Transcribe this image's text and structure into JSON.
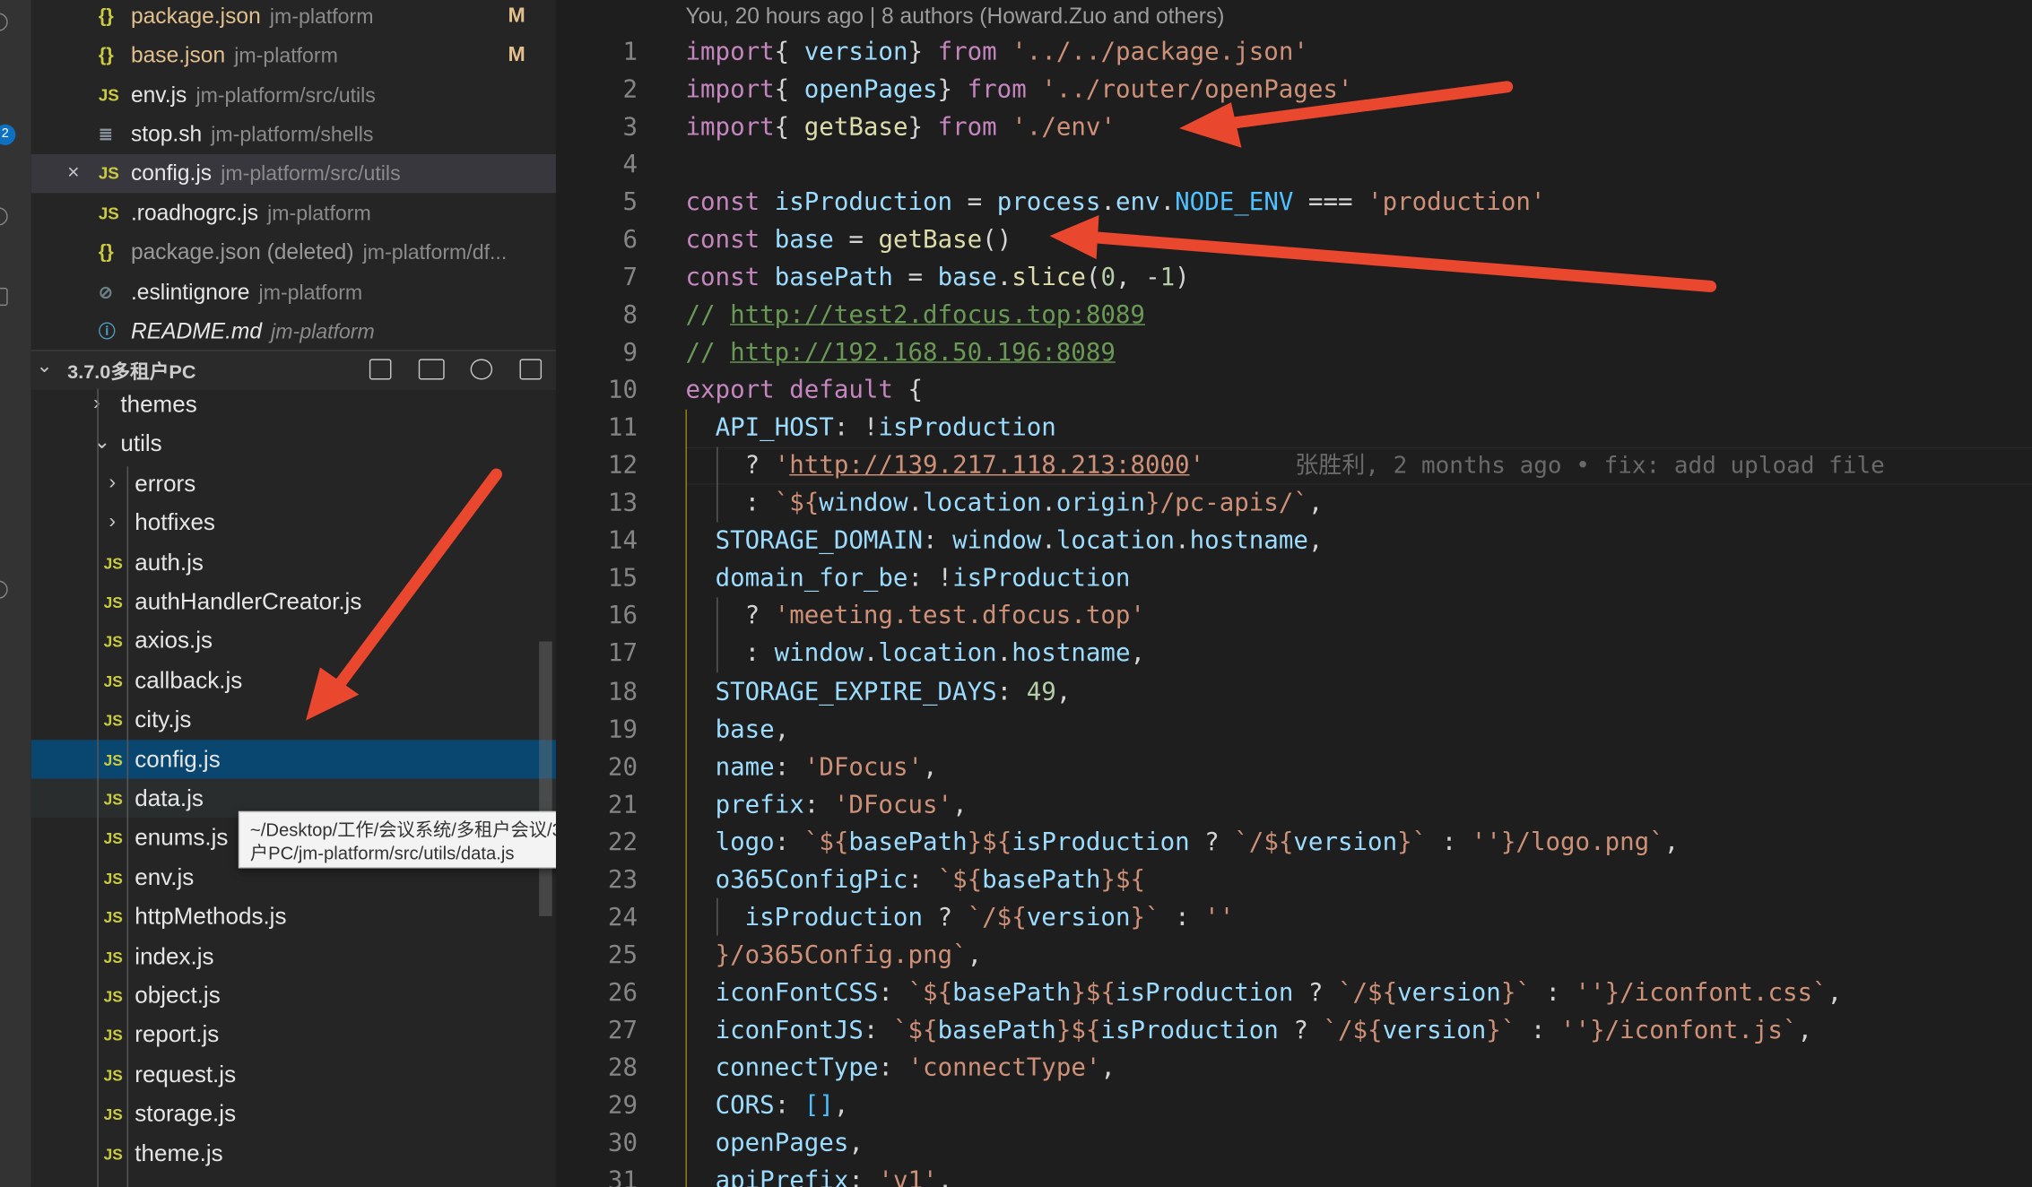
{
  "open_editors": [
    {
      "icon": "{}",
      "name": "package.json",
      "path": "jm-platform",
      "badge": "M",
      "status": "modified"
    },
    {
      "icon": "{}",
      "name": "base.json",
      "path": "jm-platform",
      "badge": "M",
      "status": "modified"
    },
    {
      "icon": "JS",
      "name": "env.js",
      "path": "jm-platform/src/utils",
      "badge": "",
      "status": ""
    },
    {
      "icon": "≣",
      "name": "stop.sh",
      "path": "jm-platform/shells",
      "badge": "",
      "status": ""
    },
    {
      "icon": "JS",
      "name": "config.js",
      "path": "jm-platform/src/utils",
      "badge": "",
      "status": "active",
      "close": "×"
    },
    {
      "icon": "JS",
      "name": ".roadhogrc.js",
      "path": "jm-platform",
      "badge": "",
      "status": ""
    },
    {
      "icon": "{}",
      "name": "package.json (deleted)",
      "path": "jm-platform/df...",
      "badge": "",
      "status": "deleted"
    },
    {
      "icon": "⊘",
      "name": ".eslintignore",
      "path": "jm-platform",
      "badge": "",
      "status": ""
    },
    {
      "icon": "ⓘ",
      "name": "README.md",
      "path": "jm-platform",
      "badge": "",
      "status": "italic"
    }
  ],
  "section": {
    "chevron": "⌄",
    "title": "3.7.0多租户PC"
  },
  "tree": [
    {
      "type": "folder",
      "label": "themes",
      "chevron": "›",
      "depth": 1
    },
    {
      "type": "folder",
      "label": "utils",
      "chevron": "⌄",
      "depth": 1
    },
    {
      "type": "folder",
      "label": "errors",
      "chevron": "›",
      "depth": 2
    },
    {
      "type": "folder",
      "label": "hotfixes",
      "chevron": "›",
      "depth": 2
    },
    {
      "type": "file",
      "label": "auth.js",
      "icon": "JS"
    },
    {
      "type": "file",
      "label": "authHandlerCreator.js",
      "icon": "JS"
    },
    {
      "type": "file",
      "label": "axios.js",
      "icon": "JS"
    },
    {
      "type": "file",
      "label": "callback.js",
      "icon": "JS"
    },
    {
      "type": "file",
      "label": "city.js",
      "icon": "JS"
    },
    {
      "type": "file",
      "label": "config.js",
      "icon": "JS",
      "state": "selected"
    },
    {
      "type": "file",
      "label": "data.js",
      "icon": "JS",
      "state": "hover"
    },
    {
      "type": "file",
      "label": "enums.js",
      "icon": "JS"
    },
    {
      "type": "file",
      "label": "env.js",
      "icon": "JS"
    },
    {
      "type": "file",
      "label": "httpMethods.js",
      "icon": "JS"
    },
    {
      "type": "file",
      "label": "index.js",
      "icon": "JS"
    },
    {
      "type": "file",
      "label": "object.js",
      "icon": "JS"
    },
    {
      "type": "file",
      "label": "report.js",
      "icon": "JS"
    },
    {
      "type": "file",
      "label": "request.js",
      "icon": "JS"
    },
    {
      "type": "file",
      "label": "storage.js",
      "icon": "JS"
    },
    {
      "type": "file",
      "label": "theme.js",
      "icon": "JS"
    }
  ],
  "tooltip": {
    "line1": "~/Desktop/工作/会议系统/多租户会议/3.7.0多租",
    "line2": "户PC/jm-platform/src/utils/data.js"
  },
  "activity_badge": "2",
  "codelens": "You, 20 hours ago | 8 authors (Howard.Zuo and others)",
  "blame": "张胜利, 2 months ago • fix: add upload file",
  "code_lines": [
    [
      [
        "k",
        "import"
      ],
      [
        "",
        "{ "
      ],
      [
        "v",
        "version"
      ],
      [
        "",
        "} "
      ],
      [
        "k",
        "from"
      ],
      [
        "",
        " "
      ],
      [
        "s",
        "'../../package.json'"
      ]
    ],
    [
      [
        "k",
        "import"
      ],
      [
        "",
        "{ "
      ],
      [
        "v",
        "openPages"
      ],
      [
        "",
        "} "
      ],
      [
        "k",
        "from"
      ],
      [
        "",
        " "
      ],
      [
        "s",
        "'../router/openPages'"
      ]
    ],
    [
      [
        "k",
        "import"
      ],
      [
        "",
        "{ "
      ],
      [
        "f",
        "getBase"
      ],
      [
        "",
        "} "
      ],
      [
        "k",
        "from"
      ],
      [
        "",
        " "
      ],
      [
        "s",
        "'./env'"
      ]
    ],
    [],
    [
      [
        "k",
        "const"
      ],
      [
        "",
        " "
      ],
      [
        "v",
        "isProduction"
      ],
      [
        "",
        " = "
      ],
      [
        "v",
        "process"
      ],
      [
        "",
        "."
      ],
      [
        "v",
        "env"
      ],
      [
        "",
        "."
      ],
      [
        "cst",
        "NODE_ENV"
      ],
      [
        "",
        " === "
      ],
      [
        "s",
        "'production'"
      ]
    ],
    [
      [
        "k",
        "const"
      ],
      [
        "",
        " "
      ],
      [
        "v",
        "base"
      ],
      [
        "",
        " = "
      ],
      [
        "f",
        "getBase"
      ],
      [
        "",
        "()"
      ]
    ],
    [
      [
        "k",
        "const"
      ],
      [
        "",
        " "
      ],
      [
        "v",
        "basePath"
      ],
      [
        "",
        " = "
      ],
      [
        "v",
        "base"
      ],
      [
        "",
        "."
      ],
      [
        "f",
        "slice"
      ],
      [
        "",
        "("
      ],
      [
        "n",
        "0"
      ],
      [
        "",
        ", -"
      ],
      [
        "n",
        "1"
      ],
      [
        "",
        ")"
      ]
    ],
    [
      [
        "c",
        "// "
      ],
      [
        "cu",
        "http://test2.dfocus.top:8089"
      ]
    ],
    [
      [
        "c",
        "// "
      ],
      [
        "cu",
        "http://192.168.50.196:8089"
      ]
    ],
    [
      [
        "k",
        "export"
      ],
      [
        "",
        " "
      ],
      [
        "k",
        "default"
      ],
      [
        "",
        " {"
      ]
    ],
    [
      [
        "",
        "  "
      ],
      [
        "v",
        "API_HOST"
      ],
      [
        "",
        ": !"
      ],
      [
        "v",
        "isProduction"
      ]
    ],
    [
      [
        "",
        "    ? "
      ],
      [
        "s",
        "'"
      ],
      [
        "su",
        "http://139.217.118.213:8000"
      ],
      [
        "s",
        "'"
      ],
      [
        "blame",
        ""
      ]
    ],
    [
      [
        "",
        "    : "
      ],
      [
        "s",
        "`${"
      ],
      [
        "v",
        "window"
      ],
      [
        "",
        "."
      ],
      [
        "v",
        "location"
      ],
      [
        "",
        "."
      ],
      [
        "v",
        "origin"
      ],
      [
        "s",
        "}/pc-apis/`"
      ],
      [
        "",
        ","
      ]
    ],
    [
      [
        "",
        "  "
      ],
      [
        "v",
        "STORAGE_DOMAIN"
      ],
      [
        "",
        ": "
      ],
      [
        "v",
        "window"
      ],
      [
        "",
        "."
      ],
      [
        "v",
        "location"
      ],
      [
        "",
        "."
      ],
      [
        "v",
        "hostname"
      ],
      [
        "",
        ","
      ]
    ],
    [
      [
        "",
        "  "
      ],
      [
        "v",
        "domain_for_be"
      ],
      [
        "",
        ": !"
      ],
      [
        "v",
        "isProduction"
      ]
    ],
    [
      [
        "",
        "    ? "
      ],
      [
        "s",
        "'meeting.test.dfocus.top'"
      ]
    ],
    [
      [
        "",
        "    : "
      ],
      [
        "v",
        "window"
      ],
      [
        "",
        "."
      ],
      [
        "v",
        "location"
      ],
      [
        "",
        "."
      ],
      [
        "v",
        "hostname"
      ],
      [
        "",
        ","
      ]
    ],
    [
      [
        "",
        "  "
      ],
      [
        "v",
        "STORAGE_EXPIRE_DAYS"
      ],
      [
        "",
        ": "
      ],
      [
        "n",
        "49"
      ],
      [
        "",
        ","
      ]
    ],
    [
      [
        "",
        "  "
      ],
      [
        "v",
        "base"
      ],
      [
        "",
        ","
      ]
    ],
    [
      [
        "",
        "  "
      ],
      [
        "v",
        "name"
      ],
      [
        "",
        ": "
      ],
      [
        "s",
        "'DFocus'"
      ],
      [
        "",
        ","
      ]
    ],
    [
      [
        "",
        "  "
      ],
      [
        "v",
        "prefix"
      ],
      [
        "",
        ": "
      ],
      [
        "s",
        "'DFocus'"
      ],
      [
        "",
        ","
      ]
    ],
    [
      [
        "",
        "  "
      ],
      [
        "v",
        "logo"
      ],
      [
        "",
        ": "
      ],
      [
        "s",
        "`${"
      ],
      [
        "v",
        "basePath"
      ],
      [
        "s",
        "}${"
      ],
      [
        "v",
        "isProduction"
      ],
      [
        "",
        " ? "
      ],
      [
        "s",
        "`/${"
      ],
      [
        "v",
        "version"
      ],
      [
        "s",
        "}`"
      ],
      [
        "",
        " : "
      ],
      [
        "s",
        "''"
      ],
      [
        "s",
        "}/logo.png`"
      ],
      [
        "",
        ","
      ]
    ],
    [
      [
        "",
        "  "
      ],
      [
        "v",
        "o365ConfigPic"
      ],
      [
        "",
        ": "
      ],
      [
        "s",
        "`${"
      ],
      [
        "v",
        "basePath"
      ],
      [
        "s",
        "}${"
      ]
    ],
    [
      [
        "",
        "    "
      ],
      [
        "v",
        "isProduction"
      ],
      [
        "",
        " ? "
      ],
      [
        "s",
        "`/${"
      ],
      [
        "v",
        "version"
      ],
      [
        "s",
        "}`"
      ],
      [
        "",
        " : "
      ],
      [
        "s",
        "''"
      ]
    ],
    [
      [
        "",
        "  "
      ],
      [
        "s",
        "}/o365Config.png`"
      ],
      [
        "",
        ","
      ]
    ],
    [
      [
        "",
        "  "
      ],
      [
        "v",
        "iconFontCSS"
      ],
      [
        "",
        ": "
      ],
      [
        "s",
        "`${"
      ],
      [
        "v",
        "basePath"
      ],
      [
        "s",
        "}${"
      ],
      [
        "v",
        "isProduction"
      ],
      [
        "",
        " ? "
      ],
      [
        "s",
        "`/${"
      ],
      [
        "v",
        "version"
      ],
      [
        "s",
        "}`"
      ],
      [
        "",
        " : "
      ],
      [
        "s",
        "''"
      ],
      [
        "s",
        "}/iconfont.css`"
      ],
      [
        "",
        ","
      ]
    ],
    [
      [
        "",
        "  "
      ],
      [
        "v",
        "iconFontJS"
      ],
      [
        "",
        ": "
      ],
      [
        "s",
        "`${"
      ],
      [
        "v",
        "basePath"
      ],
      [
        "s",
        "}${"
      ],
      [
        "v",
        "isProduction"
      ],
      [
        "",
        " ? "
      ],
      [
        "s",
        "`/${"
      ],
      [
        "v",
        "version"
      ],
      [
        "s",
        "}`"
      ],
      [
        "",
        " : "
      ],
      [
        "s",
        "''"
      ],
      [
        "s",
        "}/iconfont.js`"
      ],
      [
        "",
        ","
      ]
    ],
    [
      [
        "",
        "  "
      ],
      [
        "v",
        "connectType"
      ],
      [
        "",
        ": "
      ],
      [
        "s",
        "'connectType'"
      ],
      [
        "",
        ","
      ]
    ],
    [
      [
        "",
        "  "
      ],
      [
        "v",
        "CORS"
      ],
      [
        "",
        ": "
      ],
      [
        "cst",
        "[]"
      ],
      [
        "",
        ","
      ]
    ],
    [
      [
        "",
        "  "
      ],
      [
        "v",
        "openPages"
      ],
      [
        "",
        ","
      ]
    ],
    [
      [
        "",
        "  "
      ],
      [
        "v",
        "apiPrefix"
      ],
      [
        "",
        ": "
      ],
      [
        "s",
        "'v1'"
      ],
      [
        "",
        ","
      ]
    ]
  ],
  "colors": {
    "arrow": "#e9472e",
    "selected": "#094771",
    "accent": "#0e70c0"
  }
}
